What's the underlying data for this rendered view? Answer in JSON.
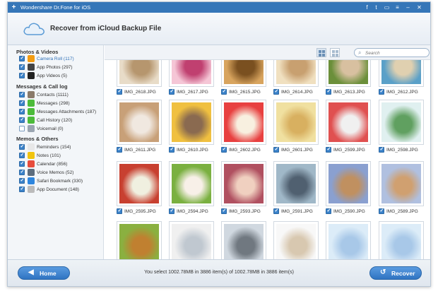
{
  "window": {
    "title": "Wondershare Dr.Fone for iOS",
    "title_icons": [
      "facebook-icon",
      "twitter-icon",
      "chat-icon",
      "menu-icon",
      "minimize-icon",
      "close-icon"
    ]
  },
  "header": {
    "title": "Recover from iCloud Backup File"
  },
  "sidebar": {
    "sections": [
      {
        "title": "Photos & Videos"
      },
      {
        "title": "Messages & Call log"
      },
      {
        "title": "Memos & Others"
      }
    ],
    "items": [
      {
        "label": "Camera Roll (117)",
        "checked": true,
        "icon": "flower-icon",
        "color": "#f39c12"
      },
      {
        "label": "App Photos (297)",
        "checked": true,
        "icon": "camera-icon",
        "color": "#444444"
      },
      {
        "label": "App Videos (5)",
        "checked": true,
        "icon": "video-icon",
        "color": "#222222"
      },
      {
        "label": "Contacts (1111)",
        "checked": true,
        "icon": "contacts-icon",
        "color": "#8a7a6a"
      },
      {
        "label": "Messages (298)",
        "checked": true,
        "icon": "message-icon",
        "color": "#4cbb3a"
      },
      {
        "label": "Messages Attachments (187)",
        "checked": true,
        "icon": "attachment-icon",
        "color": "#4cbb3a"
      },
      {
        "label": "Call History (120)",
        "checked": true,
        "icon": "phone-icon",
        "color": "#4cbb3a"
      },
      {
        "label": "Voicemail (0)",
        "checked": false,
        "icon": "voicemail-icon",
        "color": "#9aa5b1"
      },
      {
        "label": "Reminders (154)",
        "checked": true,
        "icon": "reminders-icon",
        "color": "#e8e8e8"
      },
      {
        "label": "Notes (101)",
        "checked": true,
        "icon": "notes-icon",
        "color": "#f1c40f"
      },
      {
        "label": "Calendar (856)",
        "checked": true,
        "icon": "calendar-icon",
        "color": "#e74c3c"
      },
      {
        "label": "Voice Memos (52)",
        "checked": true,
        "icon": "voice-memo-icon",
        "color": "#5d6d7e"
      },
      {
        "label": "Safari Bookmark (330)",
        "checked": true,
        "icon": "safari-icon",
        "color": "#2e86de"
      },
      {
        "label": "App Document (148)",
        "checked": true,
        "icon": "document-icon",
        "color": "#bbbbbb"
      }
    ]
  },
  "toolbar": {
    "search_placeholder": "Search"
  },
  "photos": [
    {
      "name": "IMG_2618.JPG",
      "colors": [
        "#e8dcc8",
        "#b6966e"
      ]
    },
    {
      "name": "IMG_2617.JPG",
      "colors": [
        "#f5c6d6",
        "#c04070"
      ]
    },
    {
      "name": "IMG_2615.JPG",
      "colors": [
        "#d8a45e",
        "#7a5020"
      ]
    },
    {
      "name": "IMG_2614.JPG",
      "colors": [
        "#f0e0c0",
        "#c8a070"
      ]
    },
    {
      "name": "IMG_2613.JPG",
      "colors": [
        "#6b8f3a",
        "#d8c0a0"
      ]
    },
    {
      "name": "IMG_2612.JPG",
      "colors": [
        "#5aa0c8",
        "#e0d0b0"
      ]
    },
    {
      "name": "IMG_2611.JPG",
      "colors": [
        "#c8a078",
        "#f0e8e0"
      ]
    },
    {
      "name": "IMG_2610.JPG",
      "colors": [
        "#f0c040",
        "#8a6a50"
      ]
    },
    {
      "name": "IMG_2602.JPG",
      "colors": [
        "#e84040",
        "#f8f0e0"
      ]
    },
    {
      "name": "IMG_2601.JPG",
      "colors": [
        "#f0e0a0",
        "#d8b060"
      ]
    },
    {
      "name": "IMG_2599.JPG",
      "colors": [
        "#e05050",
        "#f0f0f0"
      ]
    },
    {
      "name": "IMG_2598.JPG",
      "colors": [
        "#e0f0f0",
        "#60a060"
      ]
    },
    {
      "name": "IMG_2595.JPG",
      "colors": [
        "#c84030",
        "#f0f0e0"
      ]
    },
    {
      "name": "IMG_2594.JPG",
      "colors": [
        "#7ab040",
        "#f8f0e8"
      ]
    },
    {
      "name": "IMG_2593.JPG",
      "colors": [
        "#b05060",
        "#f0d0c0"
      ]
    },
    {
      "name": "IMG_2591.JPG",
      "colors": [
        "#a0b8c8",
        "#506070"
      ]
    },
    {
      "name": "IMG_2590.JPG",
      "colors": [
        "#8aa0d0",
        "#c09060"
      ]
    },
    {
      "name": "IMG_2589.JPG",
      "colors": [
        "#b0c0e0",
        "#d0a070"
      ]
    },
    {
      "name": "",
      "colors": [
        "#8ab040",
        "#c08030"
      ]
    },
    {
      "name": "",
      "colors": [
        "#f0f0f0",
        "#c0c8d0"
      ]
    },
    {
      "name": "",
      "colors": [
        "#d0d8e0",
        "#707880"
      ]
    },
    {
      "name": "",
      "colors": [
        "#f8f8f8",
        "#d8c8b0"
      ]
    },
    {
      "name": "",
      "colors": [
        "#dcecf8",
        "#a8c8e8"
      ]
    },
    {
      "name": "",
      "colors": [
        "#dcecf8",
        "#a8c8e8"
      ]
    }
  ],
  "footer": {
    "home_label": "Home",
    "recover_label": "Recover",
    "status": "You select 1002.78MB in 3886 item(s) of 1002.78MB in 3886 item(s)"
  }
}
